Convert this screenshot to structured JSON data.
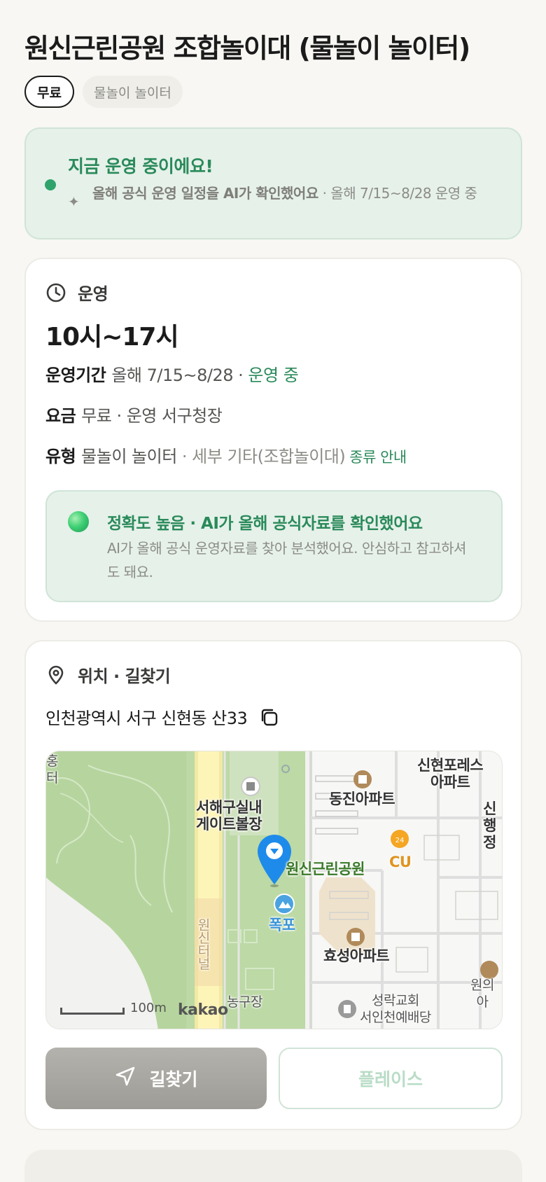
{
  "header": {
    "title": "원신근린공원 조합놀이대 (물놀이 놀이터)",
    "tags": [
      "무료",
      "물놀이 놀이터"
    ]
  },
  "status": {
    "title": "지금 운영 중이에요!",
    "desc_bold": "올해 공식 운영 일정을 AI가 확인했어요",
    "desc_rest": " · 올해 7/15~8/28 운영 중"
  },
  "operation": {
    "section_label": "운영",
    "hours": "10시~17시",
    "period_key": "운영기간",
    "period_value": "올해 7/15~8/28 · ",
    "period_status": "운영 중",
    "fee_key": "요금",
    "fee_value": "무료 · 운영 서구청장",
    "type_key": "유형",
    "type_value": "물놀이 놀이터",
    "type_detail": " · 세부 기타(조합놀이대)",
    "type_link": "종류 안내",
    "accuracy_title": "정확도 높음 · AI가 올해 공식자료를 확인했어요",
    "accuracy_desc": "AI가 올해 공식 운영자료를 찾아 분석했어요. 안심하고 참고하셔도 돼요."
  },
  "location": {
    "section_label": "위치 · 길찾기",
    "address": "인천광역시 서구 신현동 산33",
    "map": {
      "labels": {
        "seohae": "서해구실내\n게이트볼장",
        "park": "원신근린공원",
        "fountain": "폭포",
        "dongjin": "동진아파트",
        "cu": "CU",
        "hyoseong": "효성아파트",
        "sinhyeon": "신현포레스\n아파트",
        "sin_admin": "신\n행정",
        "tunnel": "원신터널",
        "court": "농구장",
        "church": "성락교회\n서인천예배당",
        "won": "원의\n아",
        "left_edge": "홍\n터"
      },
      "scale_label": "100m",
      "brand": "kakao"
    },
    "route_button": "길찾기",
    "place_button": "플레이스"
  }
}
